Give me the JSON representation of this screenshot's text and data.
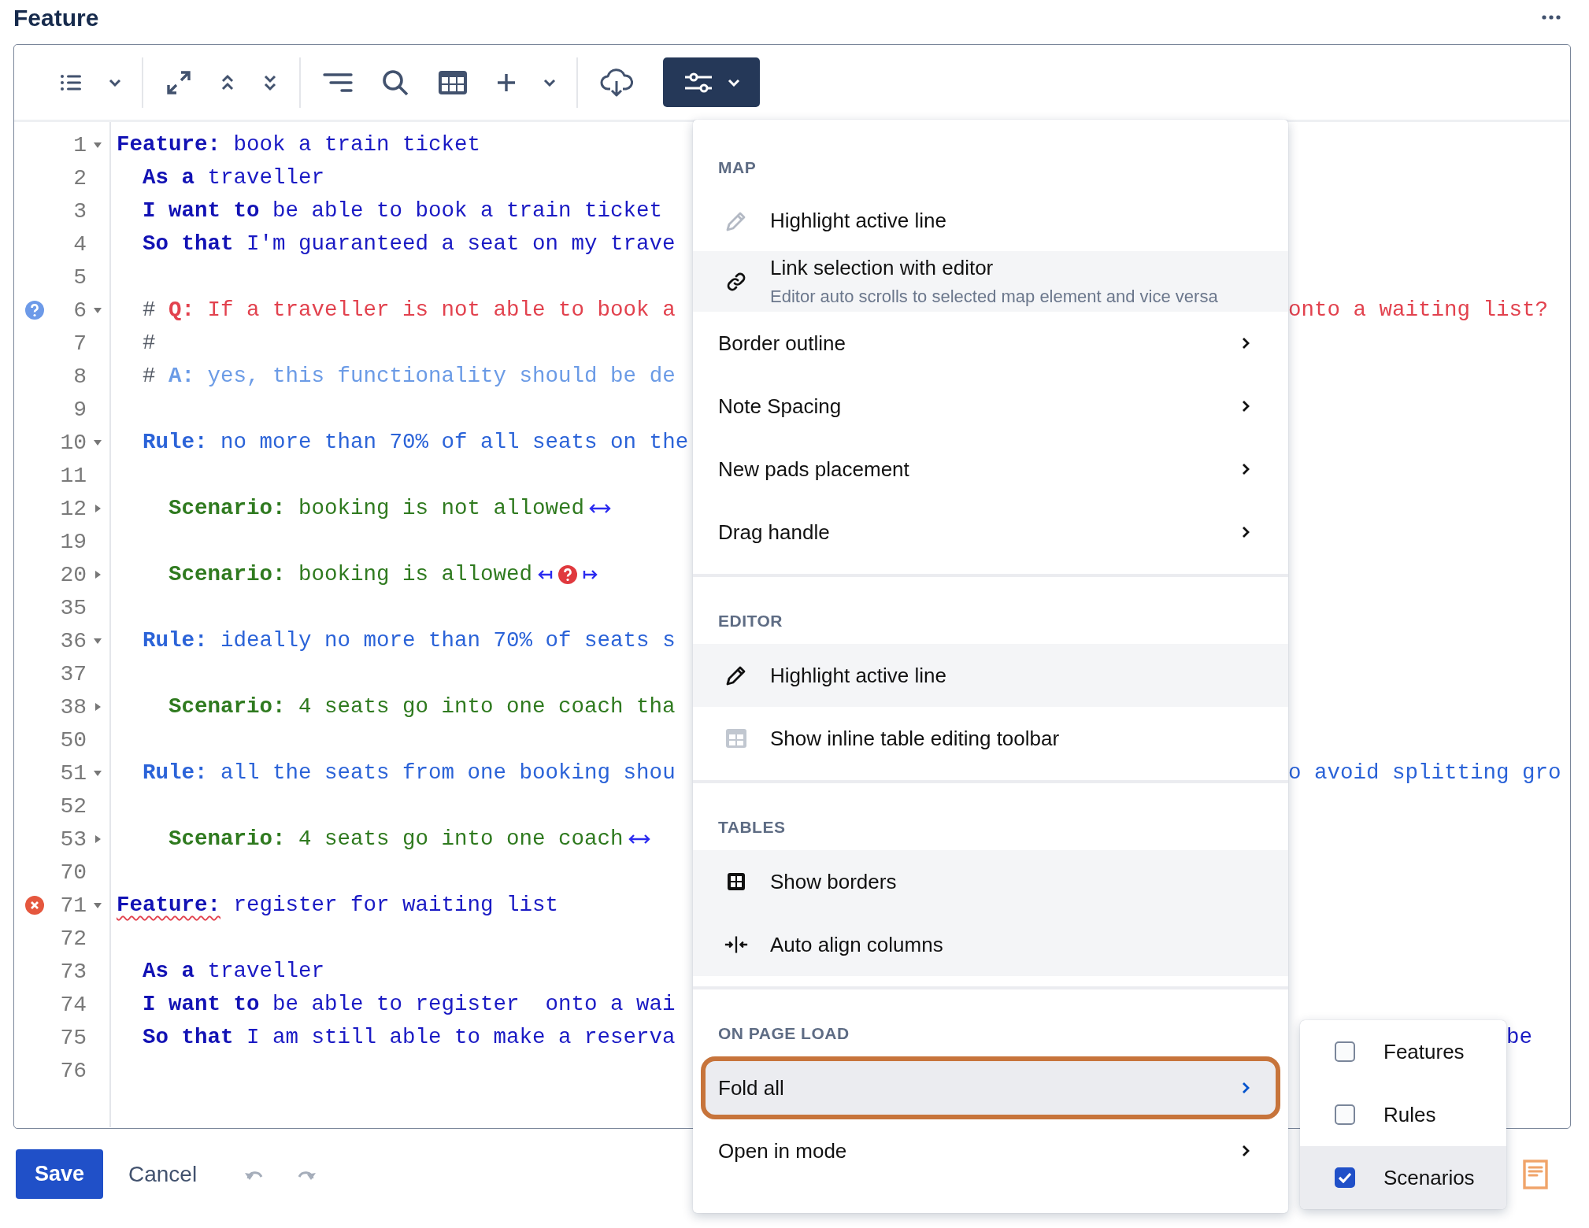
{
  "title": "Feature",
  "toolbar": {
    "settings_open": true
  },
  "lines": [
    {
      "number": "1",
      "folded": false,
      "segments": [
        {
          "kind": "keyword",
          "text": "Feature:"
        },
        {
          "kind": "text",
          "text": " book a train ticket"
        }
      ]
    },
    {
      "number": "2",
      "segments": [
        {
          "kind": "keyword",
          "text": "  As a"
        },
        {
          "kind": "text",
          "text": " traveller"
        }
      ]
    },
    {
      "number": "3",
      "segments": [
        {
          "kind": "keyword",
          "text": "  I want to"
        },
        {
          "kind": "text",
          "text": " be able to book a train ticket"
        }
      ]
    },
    {
      "number": "4",
      "segments": [
        {
          "kind": "keyword",
          "text": "  So that"
        },
        {
          "kind": "text",
          "text": " I'm guaranteed a seat on my trave"
        }
      ]
    },
    {
      "number": "5"
    },
    {
      "number": "6",
      "folded": false,
      "marker": {
        "kind": "question"
      },
      "segments": [
        {
          "kind": "comment",
          "text": "  # "
        },
        {
          "kind": "question_key",
          "text": "Q:"
        },
        {
          "kind": "question",
          "text": " If a traveller is not able to book a"
        }
      ],
      "tail": [
        {
          "kind": "question",
          "text": "onto a waiting list?"
        }
      ]
    },
    {
      "number": "7",
      "segments": [
        {
          "kind": "comment",
          "text": "  #"
        }
      ]
    },
    {
      "number": "8",
      "segments": [
        {
          "kind": "comment",
          "text": "  # "
        },
        {
          "kind": "answer_key",
          "text": "A:"
        },
        {
          "kind": "answer",
          "text": " yes, this functionality should be de"
        }
      ]
    },
    {
      "number": "9"
    },
    {
      "number": "10",
      "folded": false,
      "segments": [
        {
          "kind": "rule_key",
          "text": "  Rule:"
        },
        {
          "kind": "rule",
          "text": " no more than 70% of all seats on the"
        }
      ]
    },
    {
      "number": "11"
    },
    {
      "number": "12",
      "folded": true,
      "segments": [
        {
          "kind": "scenario_key",
          "text": "    Scenario:"
        },
        {
          "kind": "scenario",
          "text": " booking is not allowed"
        }
      ],
      "icons": [
        {
          "kind": "double-arrow"
        }
      ]
    },
    {
      "number": "19"
    },
    {
      "number": "20",
      "folded": true,
      "segments": [
        {
          "kind": "scenario_key",
          "text": "    Scenario:"
        },
        {
          "kind": "scenario",
          "text": " booking is allowed"
        }
      ],
      "icons": [
        {
          "kind": "arrow-to-left"
        },
        {
          "kind": "question"
        },
        {
          "kind": "arrow-to-right"
        }
      ]
    },
    {
      "number": "35"
    },
    {
      "number": "36",
      "folded": false,
      "segments": [
        {
          "kind": "rule_key",
          "text": "  Rule:"
        },
        {
          "kind": "rule",
          "text": " ideally no more than 70% of seats s"
        }
      ]
    },
    {
      "number": "37"
    },
    {
      "number": "38",
      "folded": true,
      "segments": [
        {
          "kind": "scenario_key",
          "text": "    Scenario:"
        },
        {
          "kind": "scenario",
          "text": " 4 seats go into one coach tha"
        }
      ]
    },
    {
      "number": "50"
    },
    {
      "number": "51",
      "folded": false,
      "segments": [
        {
          "kind": "rule_key",
          "text": "  Rule:"
        },
        {
          "kind": "rule",
          "text": " all the seats from one booking shou"
        }
      ],
      "tail": [
        {
          "kind": "rule",
          "text": "o avoid splitting gro"
        }
      ]
    },
    {
      "number": "52"
    },
    {
      "number": "53",
      "folded": true,
      "segments": [
        {
          "kind": "scenario_key",
          "text": "    Scenario:"
        },
        {
          "kind": "scenario",
          "text": " 4 seats go into one coach"
        }
      ],
      "icons": [
        {
          "kind": "double-arrow"
        }
      ]
    },
    {
      "number": "70"
    },
    {
      "number": "71",
      "folded": false,
      "marker": {
        "kind": "error"
      },
      "segments": [
        {
          "kind": "keyword",
          "text": "Feature:",
          "misspelled": true
        },
        {
          "kind": "text",
          "text": " register for waiting list"
        }
      ]
    },
    {
      "number": "72"
    },
    {
      "number": "73",
      "segments": [
        {
          "kind": "keyword",
          "text": "  As a"
        },
        {
          "kind": "text",
          "text": " traveller"
        }
      ]
    },
    {
      "number": "74",
      "segments": [
        {
          "kind": "keyword",
          "text": "  I want to"
        },
        {
          "kind": "text",
          "text": " be able to register  onto a wai"
        }
      ]
    },
    {
      "number": "75",
      "segments": [
        {
          "kind": "keyword",
          "text": "  So that"
        },
        {
          "kind": "text",
          "text": " I am still able to make a reserva"
        }
      ],
      "text_right_of_submenu": [
        {
          "kind": "text",
          "text": "be"
        }
      ]
    },
    {
      "number": "76"
    }
  ],
  "menu": {
    "sections": [
      {
        "title": "MAP",
        "items": [
          {
            "kind": "toggle",
            "label": "Highlight active line",
            "on": false
          },
          {
            "kind": "toggle",
            "label": "Link selection with editor",
            "description": "Editor auto scrolls to selected map element and vice versa",
            "on": true
          },
          {
            "kind": "submenu",
            "label": "Border outline",
            "expanded": false
          },
          {
            "kind": "submenu",
            "label": "Note Spacing",
            "expanded": false
          },
          {
            "kind": "submenu",
            "label": "New pads placement",
            "expanded": false
          },
          {
            "kind": "submenu",
            "label": "Drag handle",
            "expanded": false
          }
        ]
      },
      {
        "title": "EDITOR",
        "items": [
          {
            "kind": "toggle",
            "label": "Highlight active line",
            "on": true
          },
          {
            "kind": "toggle",
            "label": "Show inline table editing toolbar",
            "on": false
          }
        ]
      },
      {
        "title": "TABLES",
        "items": [
          {
            "kind": "toggle",
            "label": "Show borders",
            "on": true
          },
          {
            "kind": "toggle",
            "label": "Auto align columns",
            "on": true
          }
        ]
      },
      {
        "title": "ON PAGE LOAD",
        "items": [
          {
            "kind": "submenu",
            "label": "Fold all",
            "expanded": true,
            "outlined": true
          },
          {
            "kind": "submenu",
            "label": "Open in mode",
            "expanded": false
          }
        ]
      }
    ]
  },
  "submenu": {
    "items": [
      {
        "label": "Features",
        "checked": false,
        "selected": false
      },
      {
        "label": "Rules",
        "checked": false,
        "selected": false
      },
      {
        "label": "Scenarios",
        "checked": true,
        "selected": true
      }
    ]
  },
  "footer": {
    "save": "Save",
    "cancel": "Cancel"
  }
}
